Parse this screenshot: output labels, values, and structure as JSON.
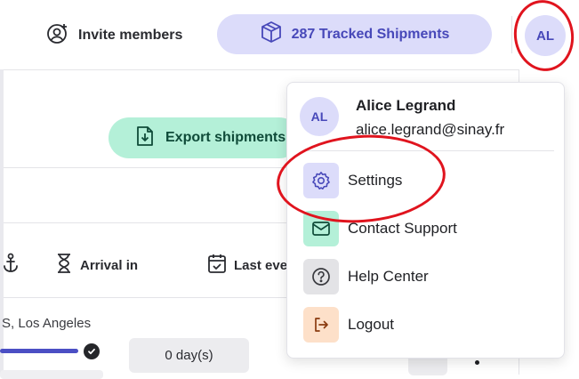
{
  "header": {
    "invite_label": "Invite members",
    "tracked_label": "287 Tracked Shipments",
    "user_initials": "AL"
  },
  "toolbar": {
    "export_label": "Export shipments"
  },
  "table": {
    "columns": [
      {
        "label": "",
        "icon": "anchor-icon"
      },
      {
        "label": "Arrival in",
        "icon": "hourglass-icon"
      },
      {
        "label": "Last eve",
        "icon": "calendar-check-icon"
      }
    ],
    "row": {
      "route": "S, Los Angeles",
      "arrival": "0 day(s)"
    }
  },
  "user_menu": {
    "initials": "AL",
    "name": "Alice Legrand",
    "email": "alice.legrand@sinay.fr",
    "items": [
      {
        "label": "Settings",
        "icon": "gear-icon",
        "color": "#dcdcfa"
      },
      {
        "label": "Contact Support",
        "icon": "mail-icon",
        "color": "#b4f0d8"
      },
      {
        "label": "Help Center",
        "icon": "question-icon",
        "color": "#e3e3e6"
      },
      {
        "label": "Logout",
        "icon": "logout-icon",
        "color": "#fde0c9"
      }
    ]
  },
  "colors": {
    "accent": "#4748b9",
    "accent_bg": "#dcdcfa",
    "annotation": "#e0141e"
  }
}
